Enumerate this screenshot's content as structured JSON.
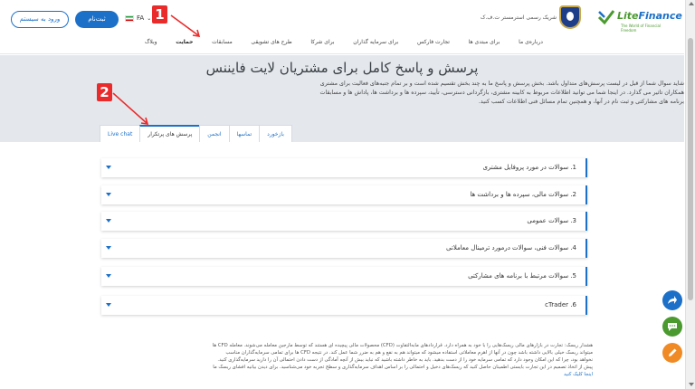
{
  "header": {
    "signup_label": "ورود به سیستم",
    "login_label": "ثبت‌نام",
    "lang_label": "FA",
    "partner_text": "شریک رسمی استرمستر ت.ف.ک",
    "logo_word1": "Lite",
    "logo_word2": "Finance",
    "logo_tagline": "The World of Financial Freedom"
  },
  "nav": {
    "items": [
      "درباره‌ی ما",
      "برای مبتدی ها",
      "تجارت فارکس",
      "برای سرمایه گذاران",
      "برای شرکا",
      "طرح های تشویقی",
      "مسابقات",
      "حمایت",
      "وبلاگ"
    ],
    "active": "حمایت"
  },
  "markers": [
    "1",
    "2"
  ],
  "hero": {
    "title": "پرسش و پاسخ کامل برای مشتریان لایت فایننس",
    "desc_lines": [
      "شاید سوال شما از قبل در لیست پرسش‌های متداول باشد. بخش پرسش و پاسخ ما به چند بخش تقسیم شده است و بر تمام جنبه‌های فعالیت برای مشتری",
      "همکاران تاثیر می گذارد. در اینجا شما می توانید اطلاعات مربوط به کابینه مشتری، بازگردانی دسترسی، تأیید، سپرده ها و برداشت ها، پاداش ها و مسابقات",
      "برنامه های مشارکتی و ثبت نام در آنها، و همچنین تمام مسائل فنی اطلاعات کسب کنید."
    ]
  },
  "tabs": [
    "Live chat",
    "پرسش های پرتکرار",
    "انجمن",
    "تماسها",
    "بازخورد"
  ],
  "faq": [
    "1. سوالات در مورد پروفایل مشتری",
    "2. سوالات مالی، سپرده ها و برداشت ها",
    "3. سوالات عمومی",
    "4. سوالات فنی، سوالات درمورد ترمینال معاملاتی",
    "5. سوالات مرتبط با برنامه های مشارکتی",
    "6. cTrader"
  ],
  "disclaimer": {
    "lines": [
      "هشدار ریسک: تجارت در بازارهای مالی ریسک‌هایی را با خود به همراه دارد. قراردادهای مابه‌التفاوت (CFD) محصولات مالی پیچیده ای هستند که توسط مارجین معامله می‌شوند. معامله CFD ها",
      "میتواند ریسک خیلی بالایی داشته باشد چون در آنها از اهرم معاملاتی استفاده میشود که میتواند هم به نفع و هم به ضرر شما عمل کند. در نتیجه CFD ها برای تمامی سرمایه‌گذاران مناسب",
      "نخواهد بود، چرا که این امکان وجود دارد که تمامی سرمایه خود را از دست بدهید. باید به خاطر داشته باشید که نباید بیش از آنچه آمادگی از دست دادن احتمالی آن را دارید سرمایه‌گذاری کنید.",
      "پیش از اتخاذ تصمیم در این تجارت بایستی اطمینان حاصل کنید که ریسک‌های دخیل و احتمالی را بر اساس اهداف سرمایه‌گذاری و سطح تجربه خود می‌شناسید. برای دیدن بیانیه افشای ریسک ما",
      "اینجا کلیک کنید"
    ]
  },
  "colors": {
    "accent": "#1c70c8",
    "brand_green": "#4a9a2f",
    "marker": "#ea2b2b"
  },
  "fabs": [
    "share-icon",
    "chat-icon",
    "edit-icon"
  ]
}
